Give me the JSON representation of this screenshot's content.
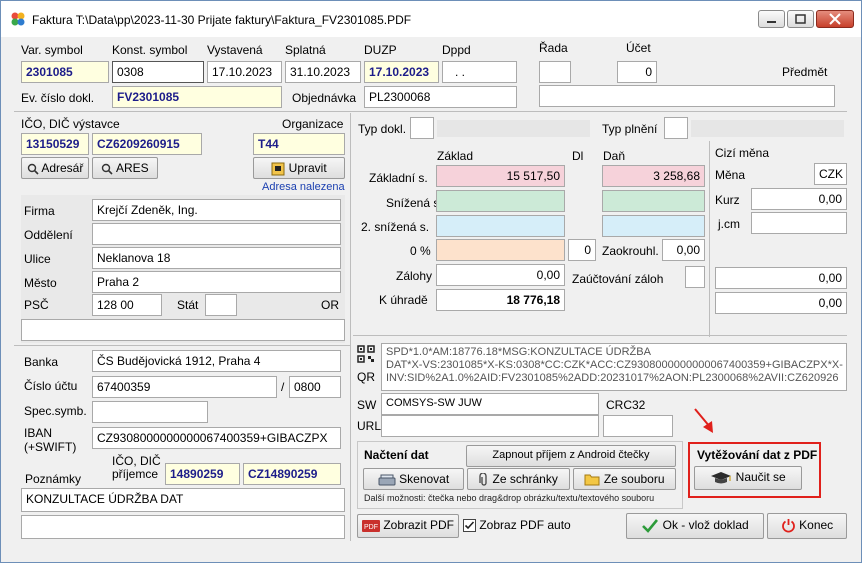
{
  "window": {
    "title": "Faktura T:\\Data\\pp\\2023-11-30 Prijate faktury\\Faktura_FV2301085.PDF",
    "controls": {
      "minimize": "–",
      "maximize": "□",
      "close": "✕"
    }
  },
  "top": {
    "labels": {
      "var_symbol": "Var. symbol",
      "konst_symbol": "Konst. symbol",
      "vystavena": "Vystavená",
      "splatna": "Splatná",
      "duzp": "DUZP",
      "dppd": "Dppd",
      "rada": "Řada",
      "ucet": "Účet",
      "predmet": "Předmět",
      "ev_cislo": "Ev. číslo dokl.",
      "objednavka": "Objednávka"
    },
    "values": {
      "var_symbol": "2301085",
      "konst_symbol": "0308",
      "vystavena": "17.10.2023",
      "splatna": "31.10.2023",
      "duzp": "17.10.2023",
      "dppd": ". .",
      "rada": "",
      "ucet": "0",
      "predmet": "",
      "ev_cislo": "FV2301085",
      "objednavka": "PL2300068"
    }
  },
  "issuer": {
    "labels": {
      "ico_dic": "IČO, DIČ výstavce",
      "organizace": "Organizace",
      "firma": "Firma",
      "oddeleni": "Oddělení",
      "ulice": "Ulice",
      "mesto": "Město",
      "psc": "PSČ",
      "stat": "Stát",
      "or": "OR"
    },
    "ico": "13150529",
    "dic": "CZ6209260915",
    "organizace": "T44",
    "btn_adresar": "Adresář",
    "btn_ares": "ARES",
    "btn_upravit": "Upravit",
    "status": "Adresa nalezena",
    "firma": "Krejčí Zdeněk, Ing.",
    "oddeleni": "",
    "ulice": "Neklanova 18",
    "mesto": "Praha 2",
    "psc": "128 00",
    "stat": "",
    "or": ""
  },
  "bank": {
    "labels": {
      "banka": "Banka",
      "cislo_uctu": "Číslo účtu",
      "slash": "/",
      "spec": "Spec.symb.",
      "iban": "IBAN\n(+SWIFT)",
      "poznamky": "Poznámky",
      "ico_dic_prijemce": "IČO, DIČ\npříjemce"
    },
    "banka": "ČS Budějovická 1912, Praha 4",
    "cislo_uctu": "67400359",
    "kod_banky": "0800",
    "spec": "",
    "iban": "CZ9308000000000067400359+GIBACZPX",
    "ico_prijemce": "14890259",
    "dic_prijemce": "CZ14890259",
    "poznamky": "KONZULTACE  ÚDRŽBA DAT"
  },
  "amounts": {
    "labels": {
      "typ_dokl": "Typ dokl.",
      "typ_plneni": "Typ plnění",
      "zaklad": "Základ",
      "dl": "Dl",
      "dan": "Daň",
      "cizi_mena": "Cizí měna",
      "zakladni": "Základní s.",
      "snizena": "Snížená s.",
      "snizena2": "2. snížená s.",
      "nula": "0 %",
      "zalohy": "Zálohy",
      "k_uhrade": "K úhradě",
      "mena": "Měna",
      "kurz": "Kurz",
      "jcm": "j.cm",
      "zaokrouhl": "Zaokrouhl.",
      "zuctovani": "Zaúčtování záloh"
    },
    "typ_dokl": "",
    "typ_plneni": "",
    "zakladni_zaklad": "15 517,50",
    "zakladni_dan": "3 258,68",
    "snizena_zaklad": "",
    "snizena_dan": "",
    "snizena2_zaklad": "",
    "snizena2_dan": "",
    "nula_zaklad": "",
    "nula_dl": "0",
    "zaokrouhl": "0,00",
    "zalohy": "0,00",
    "k_uhrade": "18 776,18",
    "mena": "CZK",
    "kurz": "0,00",
    "jcm": "",
    "cizi_1": "0,00",
    "cizi_2": "0,00"
  },
  "qr": {
    "label": "QR",
    "lines": [
      "SPD*1.0*AM:18776.18*MSG:KONZULTACE  ÚDRŽBA",
      "DAT*X-VS:2301085*X-KS:0308*CC:CZK*ACC:CZ9308000000000067400359+GIBACZPX*X-",
      "INV:SID%2A1.0%2AID:FV2301085%2ADD:20231017%2AON:PL2300068%2AVII:CZ620926"
    ],
    "sw_label": "SW",
    "sw": "COMSYS-SW JUW",
    "crc_label": "CRC32",
    "crc": "",
    "url_label": "URL",
    "url": ""
  },
  "nacteni": {
    "title": "Načtení dat",
    "android": "Zapnout příjem z Android čtečky",
    "skenovat": "Skenovat",
    "schranky": "Ze schránky",
    "souboru": "Ze souboru",
    "hint": "Další možnosti: čtečka nebo drag&drop obrázku/textu/textového souboru"
  },
  "vytezovani": {
    "title": "Vytěžování dat z PDF",
    "naucit": "Naučit se"
  },
  "bottom": {
    "zobrazit": "Zobrazit PDF",
    "zobraz_auto": "Zobraz PDF auto",
    "ok": "Ok - vlož doklad",
    "konec": "Konec"
  },
  "colors": {
    "accent_red": "#e0201b",
    "label_navy": "#1d1d8a"
  }
}
